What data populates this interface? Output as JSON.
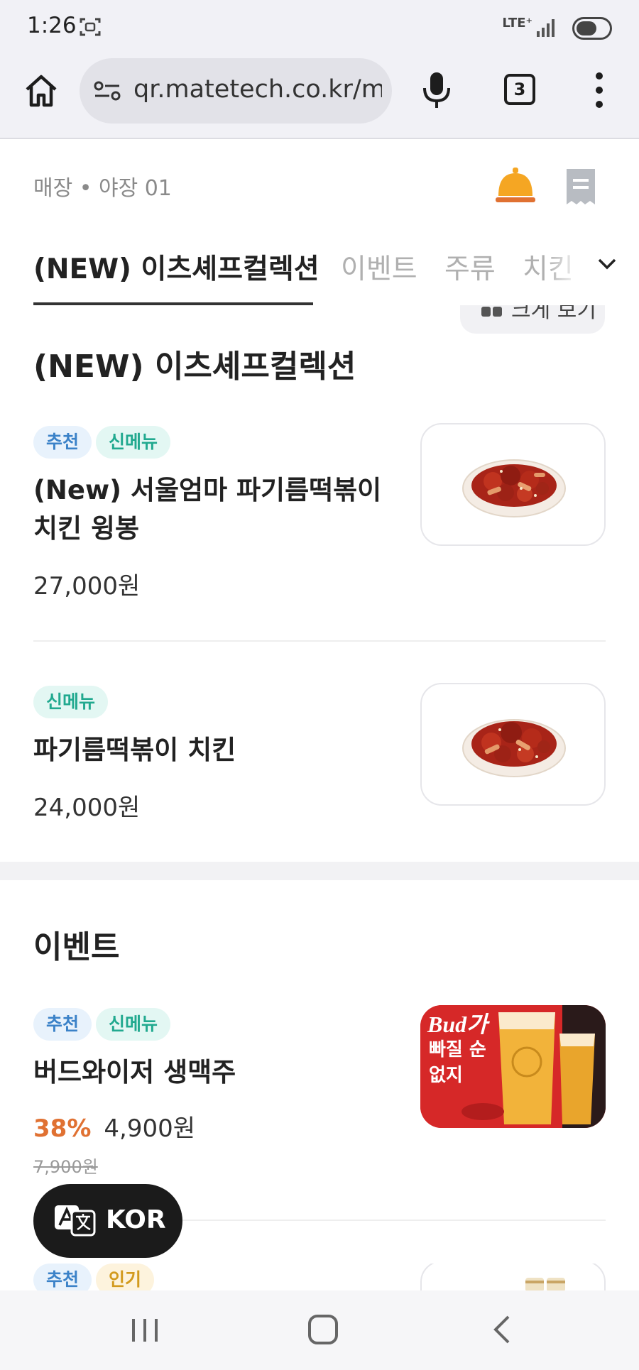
{
  "status_bar": {
    "time": "1:26",
    "network": "LTE⁺"
  },
  "browser": {
    "url": "qr.matetech.co.kr/me",
    "tab_count": "3"
  },
  "header": {
    "store_info": "매장 • 야장 01"
  },
  "tabs": [
    {
      "label": "(NEW) 이츠셰프컬렉션",
      "active": true
    },
    {
      "label": "이벤트",
      "active": false
    },
    {
      "label": "주류",
      "active": false
    },
    {
      "label": "치킨",
      "active": false
    }
  ],
  "view_toggle": {
    "label": "크게 보기"
  },
  "sections": [
    {
      "title": "(NEW) 이츠셰프컬렉션",
      "items": [
        {
          "badges": [
            "추천",
            "신메뉴"
          ],
          "name": "(New) 서울엄마 파기름떡볶이 치킨 윙봉",
          "price": "27,000원"
        },
        {
          "badges": [
            "신메뉴"
          ],
          "name": "파기름떡볶이 치킨",
          "price": "24,000원"
        }
      ]
    },
    {
      "title": "이벤트",
      "items": [
        {
          "badges": [
            "추천",
            "신메뉴"
          ],
          "name": "버드와이저 생맥주",
          "discount": "38%",
          "price": "4,900원",
          "original_price": "7,900원",
          "image_text": [
            "Bud가",
            "빠질 순",
            "없지"
          ]
        },
        {
          "badges": [
            "추천",
            "인기"
          ]
        }
      ]
    }
  ],
  "language_button": {
    "label": "KOR"
  },
  "colors": {
    "accent_orange": "#e07132",
    "badge_blue": "#3b82c8",
    "badge_teal": "#21a98f",
    "badge_yellow": "#d29a1d",
    "bell": "#f5a623",
    "bud_red": "#d62828"
  }
}
